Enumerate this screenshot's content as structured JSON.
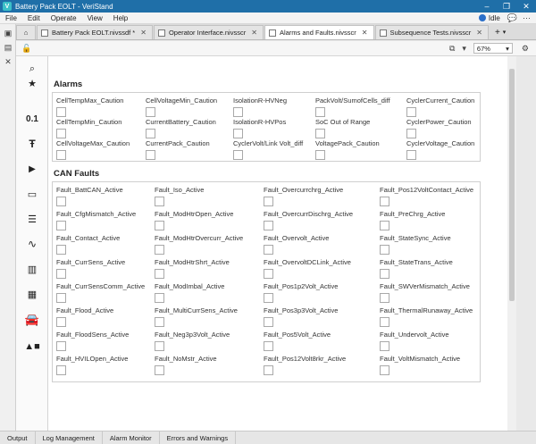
{
  "window": {
    "title": "Battery Pack EOLT - VeriStand",
    "app_letter": "V",
    "minimize": "–",
    "maximize": "❐",
    "close": "✕"
  },
  "menu": {
    "items": [
      "File",
      "Edit",
      "Operate",
      "View",
      "Help"
    ],
    "status": "Idle"
  },
  "tabs": [
    {
      "label": "Battery Pack EOLT.nivssdf *"
    },
    {
      "label": "Operator Interface.nivsscr"
    },
    {
      "label": "Alarms and Faults.nivsscr"
    },
    {
      "label": "Subsequence Tests.nivsscr"
    }
  ],
  "tab_add_label": "+",
  "toolbar": {
    "zoom": "67%"
  },
  "palette_labels": {
    "numeric": "0.1"
  },
  "alarms": {
    "title": "Alarms",
    "items": [
      "CellTempMax_Caution",
      "CellVoltageMin_Caution",
      "IsolationR-HVNeg",
      "PackVolt/SumofCells_diff",
      "CyclerCurrent_Caution",
      "CellTempMin_Caution",
      "CurrentBattery_Caution",
      "IsolationR-HVPos",
      "SoC Out of Range",
      "CyclerPower_Caution",
      "CellVoltageMax_Caution",
      "CurrentPack_Caution",
      "CyclerVolt/Link Volt_diff",
      "VoltagePack_Caution",
      "CyclerVoltage_Caution"
    ]
  },
  "can_faults": {
    "title": "CAN Faults",
    "items": [
      "Fault_BattCAN_Active",
      "Fault_Iso_Active",
      "Fault_Overcurrchrg_Active",
      "Fault_Pos12VoltContact_Active",
      "Fault_CfgMismatch_Active",
      "Fault_ModHtrOpen_Active",
      "Fault_OvercurrDischrg_Active",
      "Fault_PreChrg_Active",
      "Fault_Contact_Active",
      "Fault_ModHtrOvercurr_Active",
      "Fault_Overvolt_Active",
      "Fault_StateSync_Active",
      "Fault_CurrSens_Active",
      "Fault_ModHtrShrt_Active",
      "Fault_OvervoltDCLink_Active",
      "Fault_StateTrans_Active",
      "Fault_CurrSensComm_Active",
      "Fault_ModImbal_Active",
      "Fault_Pos1p2Volt_Active",
      "Fault_SWVerMismatch_Active",
      "Fault_Flood_Active",
      "Fault_MultiCurrSens_Active",
      "Fault_Pos3p3Volt_Active",
      "Fault_ThermalRunaway_Active",
      "Fault_FloodSens_Active",
      "Fault_Neg3p3Volt_Active",
      "Fault_Pos5Volt_Active",
      "Fault_Undervolt_Active",
      "Fault_HVILOpen_Active",
      "Fault_NoMstr_Active",
      "Fault_Pos12Volt8rkr_Active",
      "Fault_VoltMismatch_Active"
    ]
  },
  "bottom_tabs": [
    "Output",
    "Log Management",
    "Alarm Monitor",
    "Errors and Warnings"
  ]
}
